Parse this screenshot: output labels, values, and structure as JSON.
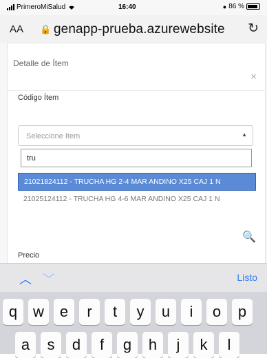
{
  "status_bar": {
    "carrier": "PrimeroMiSalud",
    "time": "16:40",
    "battery": "86 %",
    "battery_level": 0.86
  },
  "browser": {
    "aa_label": "AA",
    "url": "genapp-prueba.azurewebsite"
  },
  "modal": {
    "title": "Detalle de Ítem",
    "close_label": "×"
  },
  "form": {
    "codigo_label": "Código Ítem",
    "select_placeholder": "Seleccione Item",
    "search_value": "tru",
    "options": [
      {
        "label": "21021824112 - TRUCHA HG 2-4 MAR ANDINO X25 CAJ 1 N",
        "highlighted": true
      },
      {
        "label": "21025124112 - TRUCHA HG 4-6 MAR ANDINO X25 CAJ 1 N",
        "highlighted": false
      }
    ],
    "precio_label": "Precio"
  },
  "accessory": {
    "done_label": "Listo"
  },
  "keyboard": {
    "row1": [
      "q",
      "w",
      "e",
      "r",
      "t",
      "y",
      "u",
      "i",
      "o",
      "p"
    ],
    "row2": [
      "a",
      "s",
      "d",
      "f",
      "g",
      "h",
      "j",
      "k",
      "l"
    ]
  },
  "colors": {
    "highlight": "#5b8bd6",
    "ios_blue": "#2a7cf6"
  }
}
